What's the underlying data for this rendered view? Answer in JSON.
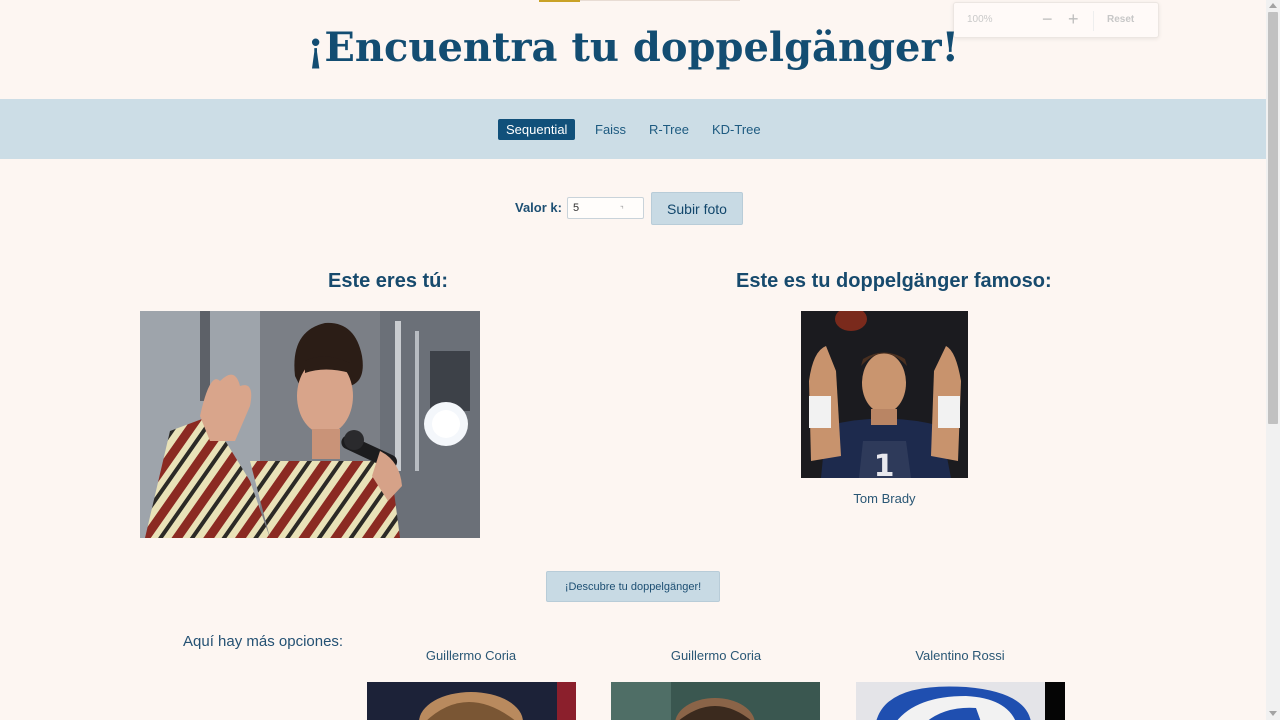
{
  "page": {
    "title": "¡Encuentra tu doppelgänger!"
  },
  "zoom": {
    "level": "100%",
    "minus": "−",
    "plus": "+",
    "reset": "Reset"
  },
  "nav": {
    "tabs": [
      {
        "label": "Sequential",
        "active": true
      },
      {
        "label": "Faiss",
        "active": false
      },
      {
        "label": "R-Tree",
        "active": false
      },
      {
        "label": "KD-Tree",
        "active": false
      }
    ]
  },
  "controls": {
    "k_label": "Valor k:",
    "k_value": "5",
    "upload_label": "Subir foto"
  },
  "you": {
    "heading": "Este eres tú:"
  },
  "match": {
    "heading": "Este es tu doppelgänger famoso:",
    "name": "Tom Brady"
  },
  "discover": {
    "label": "¡Descubre tu doppelgänger!"
  },
  "more": {
    "heading": "Aquí hay más opciones:",
    "options": [
      {
        "name": "Guillermo Coria"
      },
      {
        "name": "Guillermo Coria"
      },
      {
        "name": "Valentino Rossi"
      }
    ]
  },
  "colors": {
    "background": "#fdf6f2",
    "title": "#134d72",
    "nav_bar": "#ccdde6",
    "active_tab": "#11507a",
    "button": "#c8dae4"
  }
}
